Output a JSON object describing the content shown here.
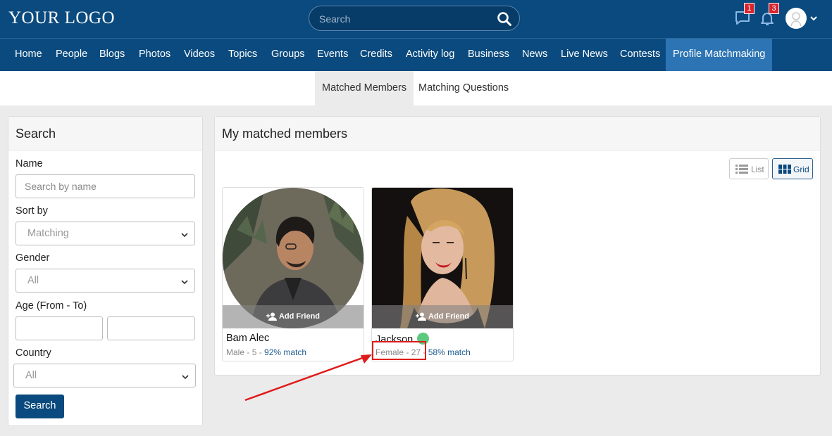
{
  "header": {
    "logo_text": "YOUR LOGO",
    "search_placeholder": "Search",
    "messages_count": "1",
    "notifications_count": "3"
  },
  "nav": {
    "items": [
      "Home",
      "People",
      "Blogs",
      "Photos",
      "Videos",
      "Topics",
      "Groups",
      "Events",
      "Credits",
      "Activity log",
      "Business",
      "News",
      "Live News",
      "Contests",
      "Profile Matchmaking"
    ],
    "active_index": 14
  },
  "subtabs": {
    "items": [
      "Matched Members",
      "Matching Questions"
    ],
    "active_index": 0
  },
  "search_panel": {
    "title": "Search",
    "name_label": "Name",
    "name_placeholder": "Search by name",
    "sort_label": "Sort by",
    "sort_value": "Matching",
    "gender_label": "Gender",
    "gender_value": "All",
    "age_label": "Age (From - To)",
    "country_label": "Country",
    "country_value": "All",
    "search_button": "Search"
  },
  "results": {
    "title": "My matched members",
    "view_list_label": "List",
    "view_grid_label": "Grid",
    "active_view": "Grid",
    "add_friend_label": "Add Friend",
    "members": [
      {
        "name": "Bam Alec",
        "gender": "Male",
        "age": "5",
        "match": "92% match",
        "online": false
      },
      {
        "name": "Jackson",
        "gender": "Female",
        "age": "27",
        "match": "58% match",
        "online": true
      }
    ]
  },
  "colors": {
    "header_bg": "#0a4a7e",
    "active_nav_bg": "#2c74b3",
    "badge": "#d9232d",
    "online": "#5cc97e",
    "annotation": "#e01b1b"
  }
}
